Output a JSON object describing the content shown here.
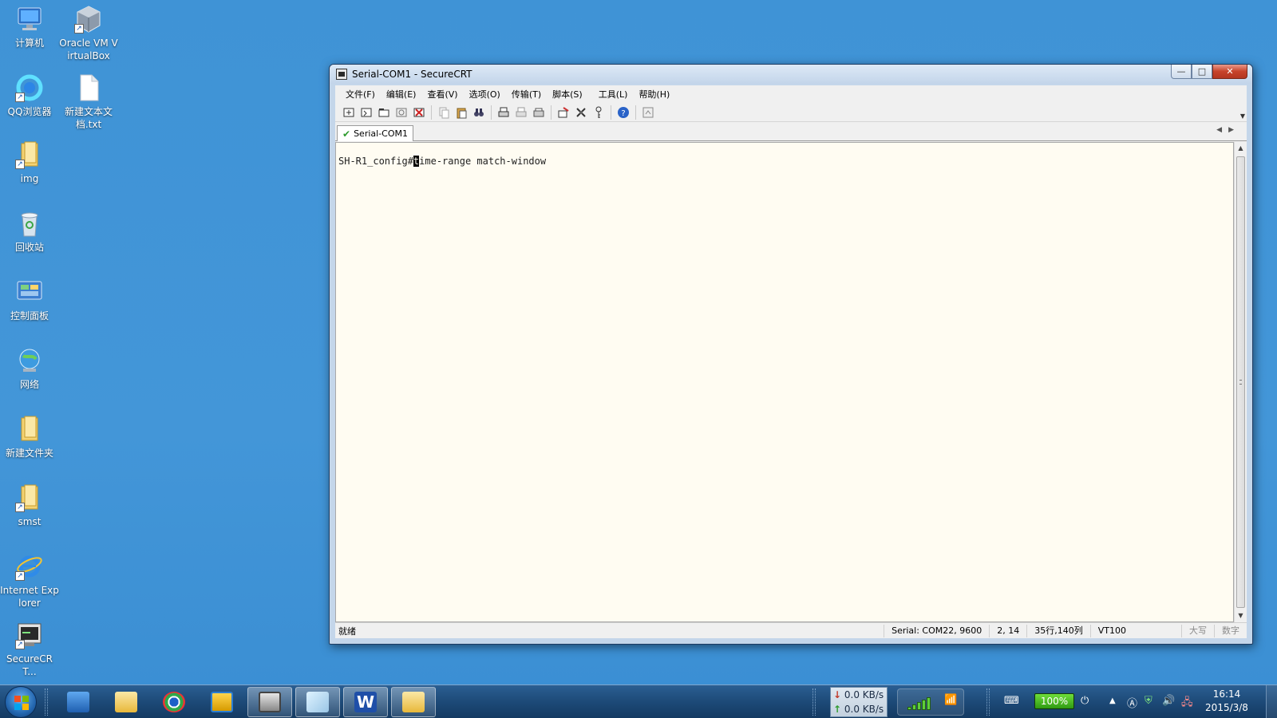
{
  "desktop": {
    "icons": [
      {
        "label": "计算机",
        "icon": "computer-icon"
      },
      {
        "label": "Oracle VM VirtualBox",
        "icon": "virtualbox-icon"
      },
      {
        "label": "QQ浏览器",
        "icon": "qq-browser-icon"
      },
      {
        "label": "新建文本文档.txt",
        "icon": "text-file-icon"
      },
      {
        "label": "img",
        "icon": "folder-icon"
      },
      {
        "label": "回收站",
        "icon": "recycle-bin-icon"
      },
      {
        "label": "控制面板",
        "icon": "control-panel-icon"
      },
      {
        "label": "网络",
        "icon": "network-icon"
      },
      {
        "label": "新建文件夹",
        "icon": "folder-icon"
      },
      {
        "label": "smst",
        "icon": "folder-icon"
      },
      {
        "label": "Internet Explorer",
        "icon": "internet-explorer-icon"
      },
      {
        "label": "SecureCRT...",
        "icon": "securecrt-icon"
      }
    ]
  },
  "window": {
    "title": "Serial-COM1 - SecureCRT",
    "controls": {
      "minimize": "—",
      "maximize": "□",
      "close": "✕"
    },
    "menu": [
      "文件(F)",
      "编辑(E)",
      "查看(V)",
      "选项(O)",
      "传输(T)",
      "脚本(S)",
      "工具(L)",
      "帮助(H)"
    ],
    "tab": {
      "label": "Serial-COM1"
    },
    "terminal": {
      "prompt": "SH-R1_config#",
      "cursor_char": "t",
      "rest": "ime-range match-window"
    },
    "status": {
      "ready": "就绪",
      "connection": "Serial: COM22, 9600",
      "position": "2, 14",
      "size": "35行,140列",
      "emulation": "VT100",
      "caps": "大写",
      "num": "数字"
    }
  },
  "taskbar": {
    "net_down": "0.0 KB/s",
    "net_up": "0.0 KB/s",
    "battery": "100%",
    "time": "16:14",
    "date": "2015/3/8"
  },
  "colors": {
    "desktop": "#4396d8",
    "terminal_bg": "#fffcf2",
    "taskbar": "#1d4a78"
  }
}
